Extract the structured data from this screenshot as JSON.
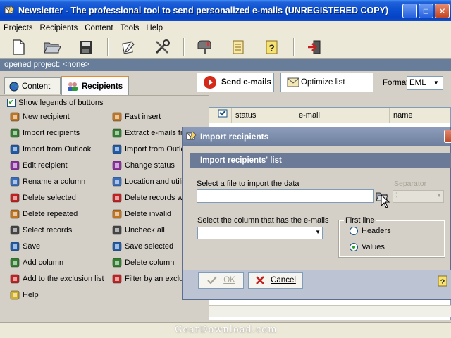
{
  "window": {
    "title": "Newsletter - The professional tool to send personalized e-mails (UNREGISTERED COPY)",
    "minimize": "_",
    "maximize": "□",
    "close": "✕"
  },
  "menu": [
    "Projects",
    "Recipients",
    "Content",
    "Tools",
    "Help"
  ],
  "toolbar_icons": [
    "new-document-icon",
    "open-folder-icon",
    "save-disk-icon",
    "edit-pen-icon",
    "tools-icon",
    "mailbox-icon",
    "scroll-icon",
    "help-icon",
    "exit-icon"
  ],
  "project": {
    "status": "opened project: <none>"
  },
  "tabs": [
    {
      "label": "Content",
      "active": false
    },
    {
      "label": "Recipients",
      "active": true
    }
  ],
  "buttons": {
    "send": "Send e-mails",
    "optimize": "Optimize list"
  },
  "format": {
    "label": "Format",
    "value": "EML"
  },
  "legends": {
    "label": "Show legends of buttons",
    "checked": true
  },
  "actions_left": [
    {
      "label": "New recipient",
      "icon": "person-icon"
    },
    {
      "label": "Import recipients",
      "icon": "import-people-icon"
    },
    {
      "label": "Import from Outlook",
      "icon": "outlook-icon"
    },
    {
      "label": "Edit recipient",
      "icon": "edit-icon"
    },
    {
      "label": "Rename a column",
      "icon": "rename-column-icon"
    },
    {
      "label": "Delete selected",
      "icon": "delete-x-icon"
    },
    {
      "label": "Delete repeated",
      "icon": "delete-repeated-icon"
    },
    {
      "label": "Select records",
      "icon": "grid-icon"
    },
    {
      "label": "Save",
      "icon": "save-icon"
    },
    {
      "label": "Add column",
      "icon": "add-column-icon"
    },
    {
      "label": "Add to the exclusion list",
      "icon": "exclusion-icon"
    },
    {
      "label": "Help",
      "icon": "help-icon"
    }
  ],
  "actions_right": [
    {
      "label": "Fast insert",
      "icon": "fast-insert-icon"
    },
    {
      "label": "Extract e-mails from",
      "icon": "extract-icon"
    },
    {
      "label": "Import from Outlook",
      "icon": "outlook-icon"
    },
    {
      "label": "Change status",
      "icon": "change-status-icon"
    },
    {
      "label": "Location and utilities",
      "icon": "location-icon"
    },
    {
      "label": "Delete records with",
      "icon": "delete-records-icon"
    },
    {
      "label": "Delete invalid",
      "icon": "delete-invalid-icon"
    },
    {
      "label": "Uncheck all",
      "icon": "uncheck-icon"
    },
    {
      "label": "Save selected",
      "icon": "save-selected-icon"
    },
    {
      "label": "Delete column",
      "icon": "delete-column-icon"
    },
    {
      "label": "Filter by an exclusio",
      "icon": "filter-icon"
    }
  ],
  "grid": {
    "columns": [
      "",
      "status",
      "e-mail",
      "name"
    ]
  },
  "dialog": {
    "title": "Import recipients",
    "header": "Import recipients' list",
    "file_label": "Select a file to import the data",
    "separator_label": "Separator",
    "separator_value": ";",
    "column_label": "Select the column that has the e-mails",
    "first_line_label": "First line",
    "options": [
      {
        "label": "Headers",
        "selected": false
      },
      {
        "label": "Values",
        "selected": true
      }
    ],
    "ok": "OK",
    "cancel": "Cancel"
  },
  "watermark": "GearDownload.com",
  "colors": {
    "titlebar": "#0a4fd0",
    "project_bar": "#687d99",
    "dialog_title": "#7a89a8",
    "dialog_header": "#6b7a96"
  }
}
